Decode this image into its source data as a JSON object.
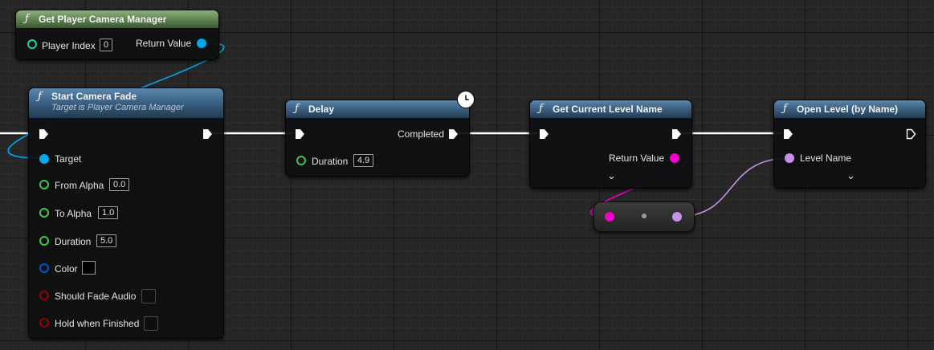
{
  "nodes": {
    "get_camera_manager": {
      "title": "Get Player Camera Manager",
      "inputs": {
        "player_index_label": "Player Index",
        "player_index_value": "0"
      },
      "outputs": {
        "return_value_label": "Return Value"
      }
    },
    "start_camera_fade": {
      "title": "Start Camera Fade",
      "subtitle": "Target is Player Camera Manager",
      "inputs": {
        "target_label": "Target",
        "from_alpha_label": "From Alpha",
        "from_alpha_value": "0.0",
        "to_alpha_label": "To Alpha",
        "to_alpha_value": "1.0",
        "duration_label": "Duration",
        "duration_value": "5.0",
        "color_label": "Color",
        "should_fade_audio_label": "Should Fade Audio",
        "hold_when_finished_label": "Hold when Finished"
      }
    },
    "delay": {
      "title": "Delay",
      "inputs": {
        "duration_label": "Duration",
        "duration_value": "4.9"
      },
      "outputs": {
        "completed_label": "Completed"
      }
    },
    "get_current_level_name": {
      "title": "Get Current Level Name",
      "outputs": {
        "return_value_label": "Return Value"
      }
    },
    "open_level": {
      "title": "Open Level (by Name)",
      "inputs": {
        "level_name_label": "Level Name"
      }
    }
  },
  "icons": {
    "function": "ƒ",
    "advanced_expand": "⌄",
    "latent": "clock-icon"
  },
  "colors": {
    "exec_wire": "#ffffff",
    "object_pin": "#00a8f0",
    "float_pin": "#3ec83e",
    "struct_pin": "#0055cc",
    "bool_pin": "#950000",
    "string_pin": "#f000c8",
    "name_pin": "#c890e8",
    "int_pin": "#1ed2a0",
    "function_header": "#3d6284",
    "pure_header": "#648a54"
  }
}
